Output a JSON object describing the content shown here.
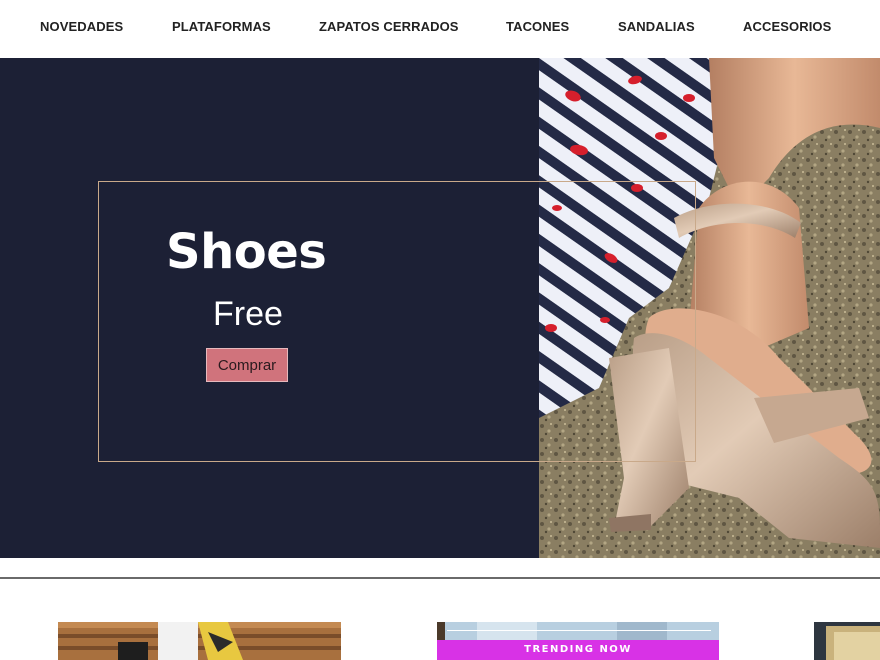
{
  "nav": {
    "items": [
      {
        "label": "NOVEDADES"
      },
      {
        "label": "PLATAFORMAS"
      },
      {
        "label": "ZAPATOS CERRADOS"
      },
      {
        "label": "TACONES"
      },
      {
        "label": "SANDALIAS"
      },
      {
        "label": "ACCESORIOS"
      }
    ]
  },
  "hero": {
    "title": "Shoes",
    "subtitle": "Free",
    "cta_label": "Comprar",
    "colors": {
      "background": "#1c2035",
      "frame": "#c9a98a",
      "cta": "#d0737c"
    }
  },
  "cards": {
    "trending_label": "TRENDING NOW",
    "colors": {
      "trending": "#d832e6"
    }
  }
}
